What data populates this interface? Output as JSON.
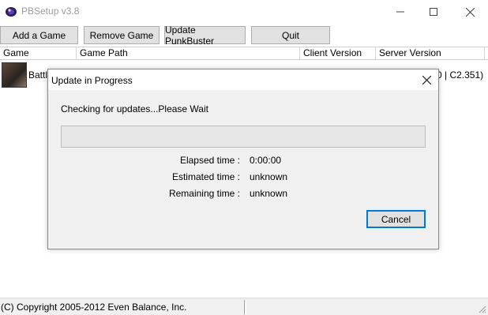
{
  "window": {
    "title": "PBSetup v3.8",
    "icon": "pb-app-icon"
  },
  "toolbar": {
    "add_game": "Add a Game",
    "remove_game": "Remove Game",
    "update_pb": "Update PunkBuster",
    "quit": "Quit"
  },
  "list": {
    "columns": [
      "Game",
      "Game Path",
      "Client Version",
      "Server Version"
    ],
    "rows": [
      {
        "game": "Battle",
        "server_version": "0 | C2.351)"
      }
    ]
  },
  "status": {
    "copyright": "(C) Copyright 2005-2012 Even Balance, Inc."
  },
  "dialog": {
    "title": "Update in Progress",
    "message": "Checking for updates...Please Wait",
    "progress_fraction": 0,
    "elapsed_label": "Elapsed time :",
    "elapsed_value": "0:00:00",
    "estimated_label": "Estimated time :",
    "estimated_value": "unknown",
    "remaining_label": "Remaining time :",
    "remaining_value": "unknown",
    "cancel_label": "Cancel"
  },
  "colors": {
    "accent": "#0078d7",
    "progress_fill": "#06b025",
    "button_face": "#e1e1e1"
  }
}
